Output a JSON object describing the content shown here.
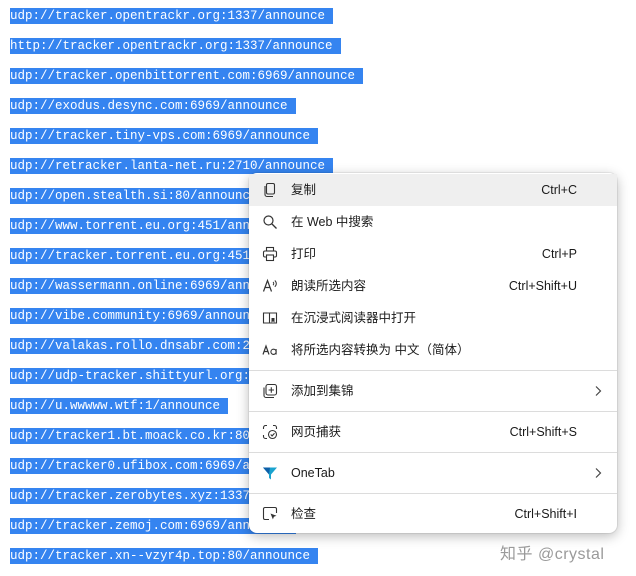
{
  "tracker_list": [
    "udp://tracker.opentrackr.org:1337/announce",
    "http://tracker.opentrackr.org:1337/announce",
    "udp://tracker.openbittorrent.com:6969/announce",
    "udp://exodus.desync.com:6969/announce",
    "udp://tracker.tiny-vps.com:6969/announce",
    "udp://retracker.lanta-net.ru:2710/announce",
    "udp://open.stealth.si:80/announce",
    "udp://www.torrent.eu.org:451/announce",
    "udp://tracker.torrent.eu.org:451/announce",
    "udp://wassermann.online:6969/announce",
    "udp://vibe.community:6969/announce",
    "udp://valakas.rollo.dnsabr.com:2710/announce",
    "udp://udp-tracker.shittyurl.org:6969/announce",
    "udp://u.wwwww.wtf:1/announce",
    "udp://tracker1.bt.moack.co.kr:80/announce",
    "udp://tracker0.ufibox.com:6969/announce",
    "udp://tracker.zerobytes.xyz:1337/announce",
    "udp://tracker.zemoj.com:6969/announce",
    "udp://tracker.xn--vzyr4p.top:80/announce"
  ],
  "selection_color": "#3584f0",
  "context_menu": {
    "copy": {
      "label": "复制",
      "shortcut": "Ctrl+C",
      "icon": "copy-icon"
    },
    "search_web": {
      "label": "在 Web 中搜索",
      "icon": "search-icon"
    },
    "print": {
      "label": "打印",
      "shortcut": "Ctrl+P",
      "icon": "printer-icon"
    },
    "read_aloud": {
      "label": "朗读所选内容",
      "shortcut": "Ctrl+Shift+U",
      "icon": "read-aloud-icon"
    },
    "immersive_reader": {
      "label": "在沉浸式阅读器中打开",
      "icon": "immersive-reader-icon"
    },
    "translate": {
      "label": "将所选内容转换为 中文（简体）",
      "icon": "translate-icon"
    },
    "collections": {
      "label": "添加到集锦",
      "icon": "collections-icon"
    },
    "web_capture": {
      "label": "网页捕获",
      "shortcut": "Ctrl+Shift+S",
      "icon": "web-capture-icon"
    },
    "onetab": {
      "label": "OneTab",
      "icon": "onetab-icon"
    },
    "inspect": {
      "label": "检查",
      "shortcut": "Ctrl+Shift+I",
      "icon": "inspect-icon"
    }
  },
  "watermark": "知乎 @crystal"
}
